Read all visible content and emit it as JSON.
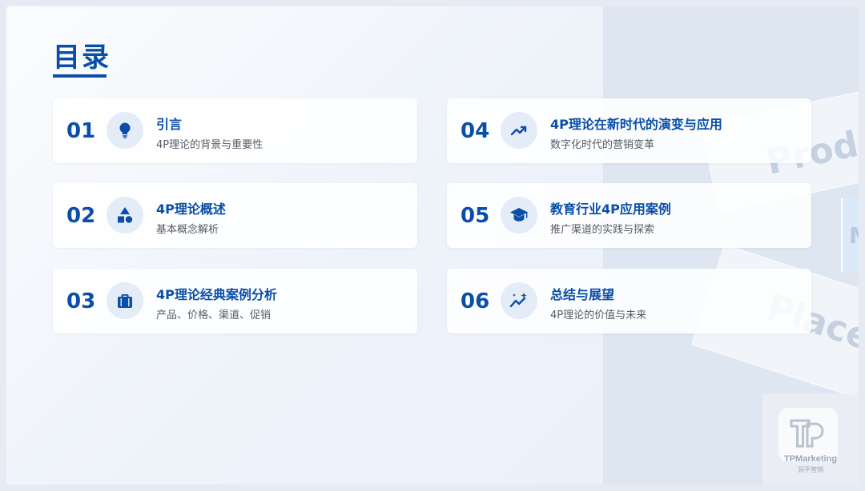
{
  "page": {
    "title": "目录",
    "accent_color": "#0a4ea8"
  },
  "items": [
    {
      "num": "01",
      "title": "引言",
      "subtitle": "4P理论的背景与重要性",
      "icon": "lightbulb-icon"
    },
    {
      "num": "02",
      "title": "4P理论概述",
      "subtitle": "基本概念解析",
      "icon": "shapes-icon"
    },
    {
      "num": "03",
      "title": "4P理论经典案例分析",
      "subtitle": "产品、价格、渠道、促销",
      "icon": "briefcase-icon"
    },
    {
      "num": "04",
      "title": "4P理论在新时代的演变与应用",
      "subtitle": "数字化时代的营销变革",
      "icon": "trending-up-icon"
    },
    {
      "num": "05",
      "title": "教育行业4P应用案例",
      "subtitle": "推广渠道的实践与探索",
      "icon": "graduation-cap-icon"
    },
    {
      "num": "06",
      "title": "总结与展望",
      "subtitle": "4P理论的价值与未来",
      "icon": "sparkle-chart-icon"
    }
  ],
  "decor": {
    "text_1": "Produ",
    "text_2": "Place",
    "strip_letter": "M"
  },
  "watermark": {
    "name": "TPMarketing",
    "cn_name": "洞平营销"
  }
}
